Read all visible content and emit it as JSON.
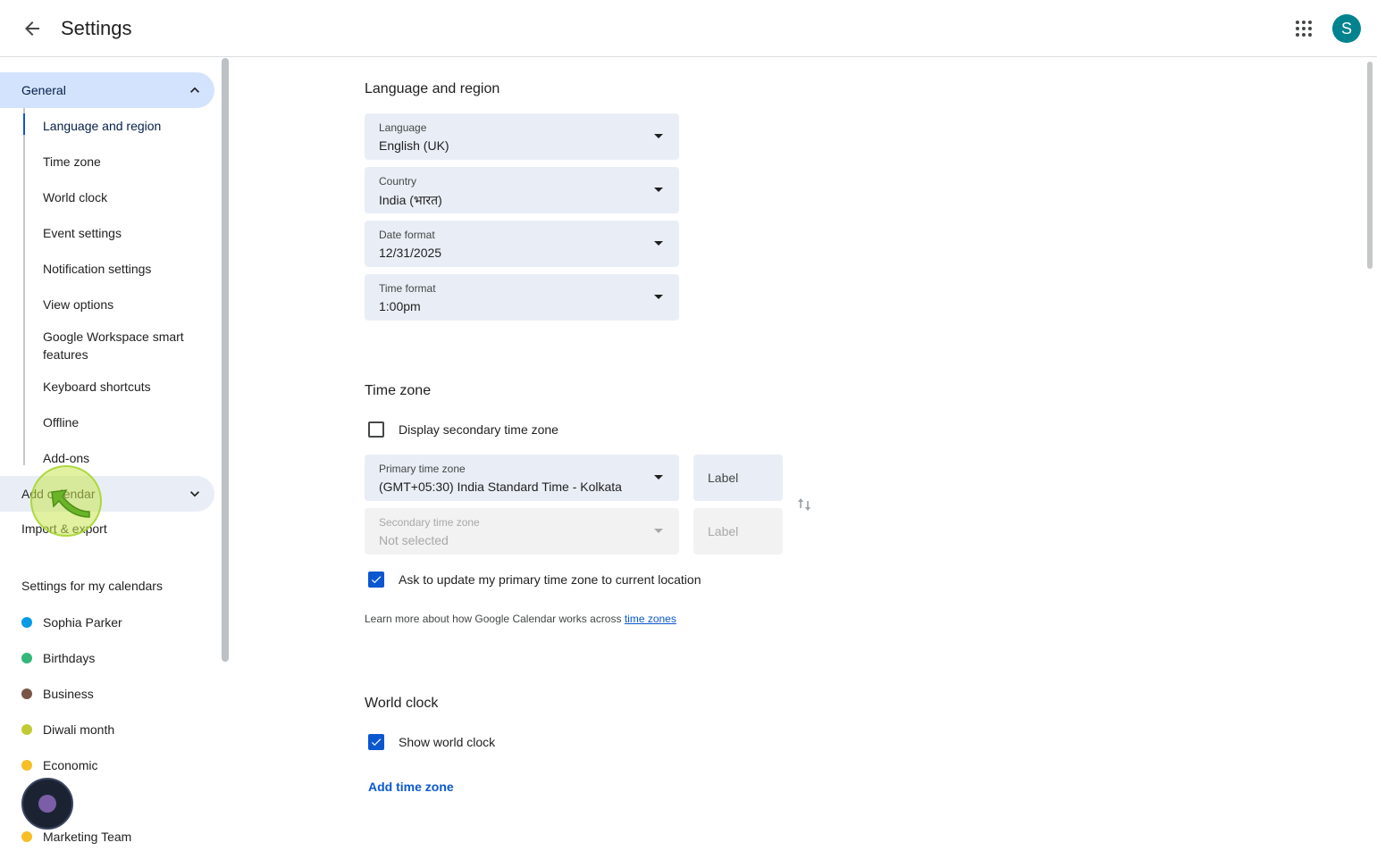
{
  "header": {
    "title": "Settings",
    "avatar_initial": "S",
    "avatar_color": "#00838f"
  },
  "sidebar": {
    "general_label": "General",
    "general_items": [
      "Language and region",
      "Time zone",
      "World clock",
      "Event settings",
      "Notification settings",
      "View options",
      "Google Workspace smart features",
      "Keyboard shortcuts",
      "Offline",
      "Add-ons"
    ],
    "add_calendar_label": "Add calendar",
    "import_export_label": "Import & export",
    "my_calendars_title": "Settings for my calendars",
    "calendars": [
      {
        "name": "Sophia Parker",
        "color": "#039be5"
      },
      {
        "name": "Birthdays",
        "color": "#33b679"
      },
      {
        "name": "Business",
        "color": "#795548"
      },
      {
        "name": "Diwali month",
        "color": "#c0ca33"
      },
      {
        "name": "Economic",
        "color": "#f6bf26"
      },
      {
        "name": "Marketing Team",
        "color": "#f6bf26"
      }
    ]
  },
  "main": {
    "language_region": {
      "title": "Language and region",
      "language": {
        "label": "Language",
        "value": "English (UK)"
      },
      "country": {
        "label": "Country",
        "value": "India (भारत)"
      },
      "date_format": {
        "label": "Date format",
        "value": "12/31/2025"
      },
      "time_format": {
        "label": "Time format",
        "value": "1:00pm"
      }
    },
    "time_zone": {
      "title": "Time zone",
      "display_secondary_label": "Display secondary time zone",
      "display_secondary_checked": false,
      "primary": {
        "label": "Primary time zone",
        "value": "(GMT+05:30) India Standard Time - Kolkata"
      },
      "primary_label_placeholder": "Label",
      "secondary": {
        "label": "Secondary time zone",
        "value": "Not selected"
      },
      "secondary_label_placeholder": "Label",
      "ask_update_label": "Ask to update my primary time zone to current location",
      "ask_update_checked": true,
      "learn_more_text": "Learn more about how Google Calendar works across ",
      "learn_more_link": "time zones"
    },
    "world_clock": {
      "title": "World clock",
      "show_label": "Show world clock",
      "show_checked": true,
      "add_time_zone": "Add time zone"
    }
  }
}
